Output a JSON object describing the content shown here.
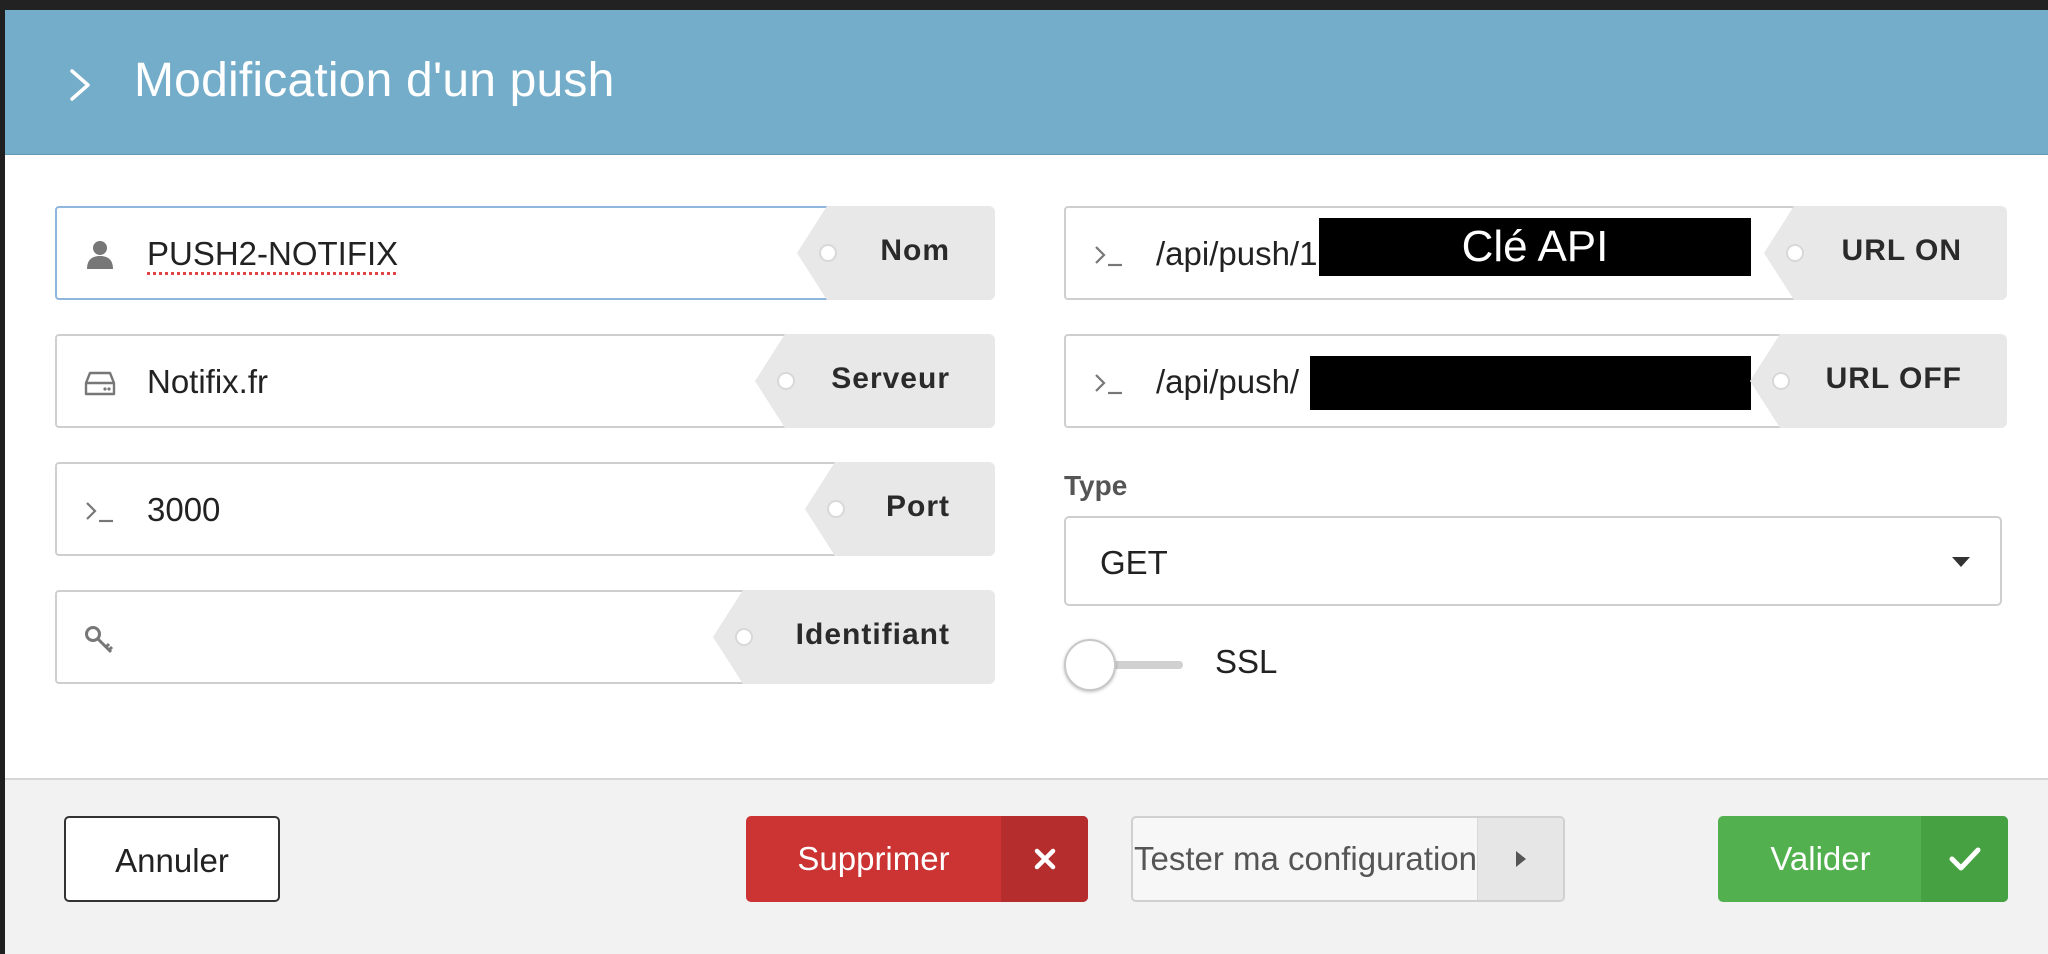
{
  "modal": {
    "title": "Modification d'un push"
  },
  "fields": {
    "nom": {
      "value": "PUSH2-NOTIFIX",
      "label": "Nom",
      "icon": "user-icon"
    },
    "serveur": {
      "value": "Notifix.fr",
      "label": "Serveur",
      "icon": "server-icon"
    },
    "port": {
      "value": "3000",
      "label": "Port",
      "icon": "terminal-icon"
    },
    "identifiant": {
      "value": "",
      "label": "Identifiant",
      "icon": "key-icon"
    },
    "url_on": {
      "value": "/api/push/1",
      "label": "URL ON",
      "redaction_text": "Clé API",
      "icon": "terminal-icon"
    },
    "url_off": {
      "value": "/api/push/",
      "label": "URL OFF",
      "icon": "terminal-icon"
    }
  },
  "type_select": {
    "label": "Type",
    "selected": "GET"
  },
  "ssl_toggle": {
    "label": "SSL",
    "checked": false
  },
  "footer": {
    "cancel_label": "Annuler",
    "delete_label": "Supprimer",
    "test_label": "Tester ma configuration",
    "validate_label": "Valider"
  },
  "colors": {
    "header_bg": "#74adc9",
    "delete": "#cc3333",
    "validate": "#52b14e"
  }
}
